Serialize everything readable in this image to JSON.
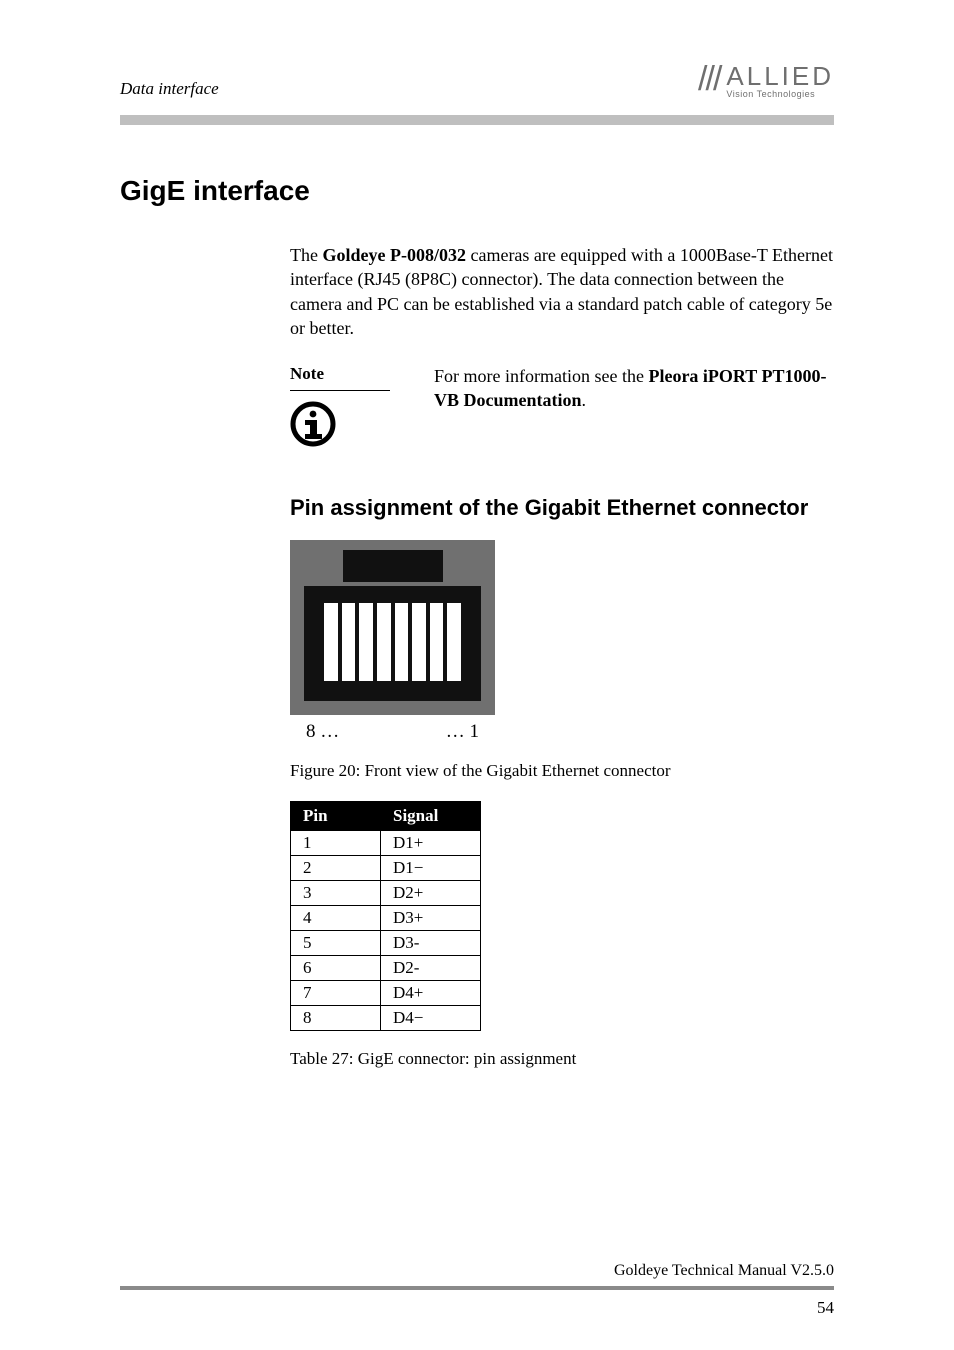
{
  "header": {
    "section_label": "Data interface",
    "logo_main": "ALLIED",
    "logo_sub": "Vision Technologies"
  },
  "h1": "GigE interface",
  "intro": {
    "product": "Goldeye P-008/032",
    "text_before": "The ",
    "text_after": " cameras are equipped with a 1000Base-T Ethernet interface (RJ45 (8P8C) connector). The data connection between the camera and PC can be established via a standard patch cable of category 5e or better."
  },
  "note": {
    "label": "Note",
    "text_before": "For more information see the ",
    "ref": "Pleora iPORT PT1000-VB Documentation",
    "text_after": "."
  },
  "h2": "Pin assignment of the Gigabit Ethernet connector",
  "figure": {
    "num_left": "8 …",
    "num_right": "… 1",
    "caption": "Figure 20: Front view of the Gigabit Ethernet connector"
  },
  "pintable": {
    "headers": [
      "Pin",
      "Signal"
    ],
    "rows": [
      [
        "1",
        "D1+"
      ],
      [
        "2",
        "D1−"
      ],
      [
        "3",
        "D2+"
      ],
      [
        "4",
        "D3+"
      ],
      [
        "5",
        "D3-"
      ],
      [
        "6",
        "D2-"
      ],
      [
        "7",
        "D4+"
      ],
      [
        "8",
        "D4−"
      ]
    ],
    "caption": "Table 27: GigE connector: pin assignment"
  },
  "footer": {
    "doc": "Goldeye Technical Manual V2.5.0",
    "page": "54"
  }
}
